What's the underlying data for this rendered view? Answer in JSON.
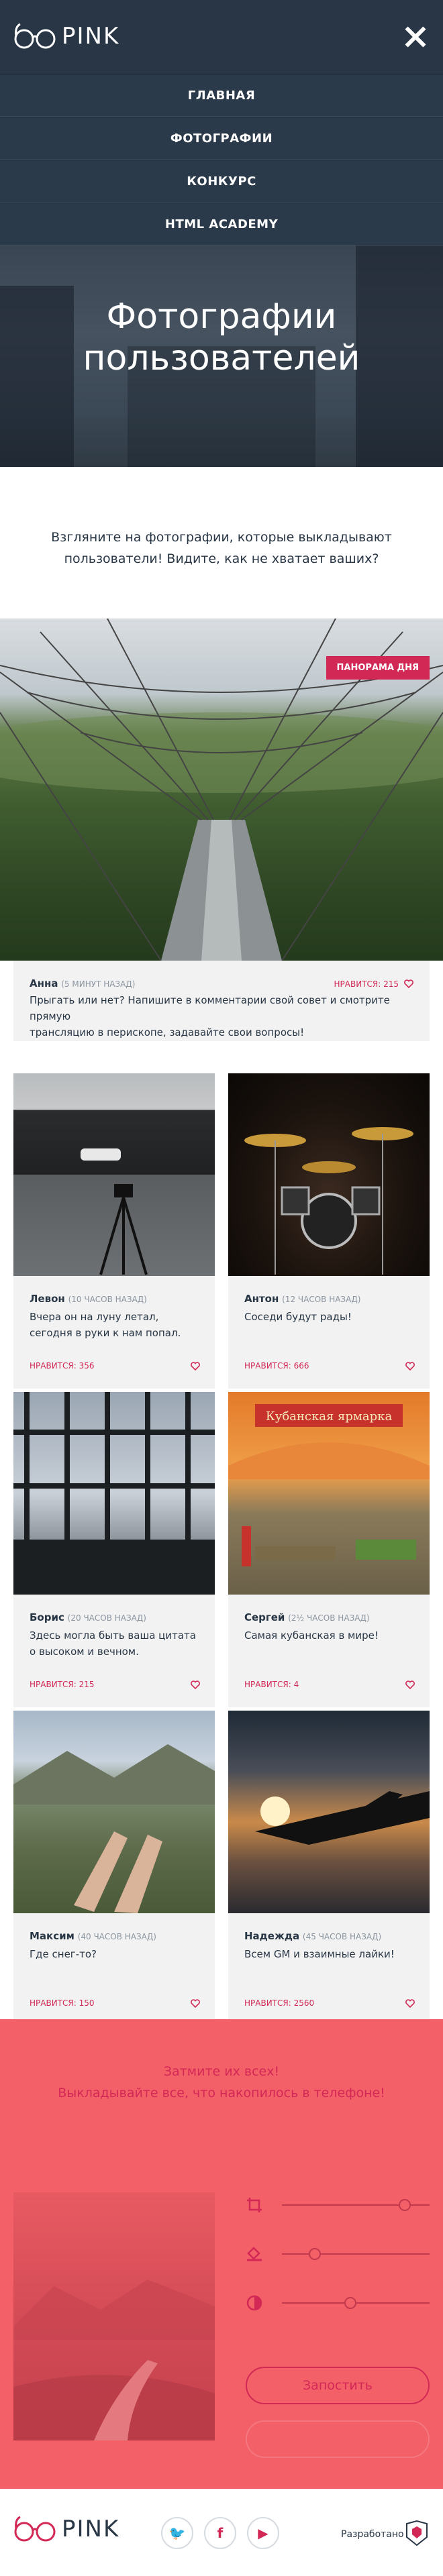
{
  "brand": {
    "name": "PINK"
  },
  "nav": {
    "items": [
      {
        "label": "ГЛАВНАЯ"
      },
      {
        "label": "ФОТОГРАФИИ"
      },
      {
        "label": "КОНКУРС"
      },
      {
        "label": "HTML ACADEMY"
      }
    ],
    "close_icon": "close-icon"
  },
  "hero": {
    "title_line1": "Фотографии",
    "title_line2": "пользователей"
  },
  "intro": {
    "line1": "Взгляните на фотографии, которые выкладывают",
    "line2": "пользователи! Видите, как не хватает ваших?"
  },
  "panorama": {
    "badge": "ПАНОРАМА ДНЯ",
    "author": "Анна",
    "time": "(5 МИНУТ НАЗАД)",
    "likes": "НРАВИТСЯ: 215",
    "comment_line1": "Прыгать или нет? Напишите в комментарии свой совет и смотрите прямую",
    "comment_line2": "трансляцию в перископе, задавайте свои вопросы!"
  },
  "photos": [
    {
      "author": "Левон",
      "time": "(10 ЧАСОВ НАЗАД)",
      "comment": "Вчера он на луну летал, сегодня в руки к нам попал.",
      "likes": "НРАВИТСЯ: 356"
    },
    {
      "author": "Антон",
      "time": "(12 ЧАСОВ НАЗАД)",
      "comment": "Соседи будут рады!",
      "likes": "НРАВИТСЯ: 666"
    },
    {
      "author": "Борис",
      "time": "(20 ЧАСОВ НАЗАД)",
      "comment": "Здесь могла быть ваша цитата о высоком и вечном.",
      "likes": "НРАВИТСЯ: 215"
    },
    {
      "author": "Сергей",
      "time": "(2½ ЧАСОВ НАЗАД)",
      "comment": "Самая кубанская в мире!",
      "likes": "НРАВИТСЯ: 4"
    },
    {
      "author": "Максим",
      "time": "(40 ЧАСОВ НАЗАД)",
      "comment": "Где снег-то?",
      "likes": "НРАВИТСЯ: 150"
    },
    {
      "author": "Надежда",
      "time": "(45 ЧАСОВ НАЗАД)",
      "comment": "Всем GM и взаимные лайки!",
      "likes": "НРАВИТСЯ: 2560"
    }
  ],
  "contest": {
    "line1": "Затмите их всех!",
    "line2": "Выкладывайте все, что накопилось в телефоне!",
    "sliders": [
      {
        "icon": "crop-icon",
        "value": 0.86
      },
      {
        "icon": "fill-icon",
        "value": 0.2
      },
      {
        "icon": "contrast-icon",
        "value": 0.46
      }
    ],
    "upload_label": "Запостить"
  },
  "footer": {
    "made_by": "Разработано",
    "social": [
      {
        "icon": "twitter-icon",
        "glyph": "🐦"
      },
      {
        "icon": "facebook-icon",
        "glyph": "f"
      },
      {
        "icon": "youtube-icon",
        "glyph": "▶"
      }
    ]
  },
  "colors": {
    "header_bg": "#283645",
    "accent": "#d22856",
    "contest_bg": "#f36068",
    "card_bg": "#f2f2f2"
  }
}
